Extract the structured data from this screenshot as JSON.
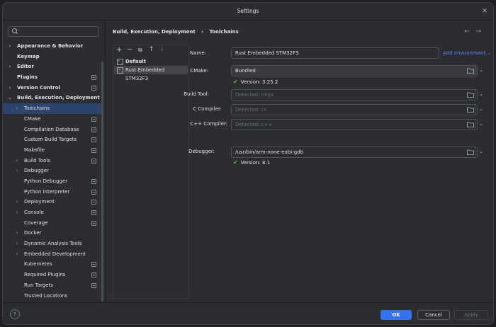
{
  "window": {
    "title": "Settings"
  },
  "search": {
    "placeholder": "",
    "value": ""
  },
  "sidebar": {
    "items": [
      {
        "label": "Appearance & Behavior",
        "level": 0,
        "arrow": "›",
        "bold": true,
        "settings_icon": false
      },
      {
        "label": "Keymap",
        "level": 0,
        "arrow": "",
        "bold": true,
        "settings_icon": false
      },
      {
        "label": "Editor",
        "level": 0,
        "arrow": "›",
        "bold": true,
        "settings_icon": false
      },
      {
        "label": "Plugins",
        "level": 0,
        "arrow": "",
        "bold": true,
        "settings_icon": true
      },
      {
        "label": "Version Control",
        "level": 0,
        "arrow": "›",
        "bold": true,
        "settings_icon": true
      },
      {
        "label": "Build, Execution, Deployment",
        "level": 0,
        "arrow": "⌄",
        "bold": true,
        "settings_icon": false
      },
      {
        "label": "Toolchains",
        "level": 1,
        "arrow": "›",
        "bold": false,
        "settings_icon": false,
        "selected": true
      },
      {
        "label": "CMake",
        "level": 1,
        "arrow": "",
        "bold": false,
        "settings_icon": true
      },
      {
        "label": "Compilation Database",
        "level": 1,
        "arrow": "",
        "bold": false,
        "settings_icon": true
      },
      {
        "label": "Custom Build Targets",
        "level": 1,
        "arrow": "",
        "bold": false,
        "settings_icon": true
      },
      {
        "label": "Makefile",
        "level": 1,
        "arrow": "",
        "bold": false,
        "settings_icon": true
      },
      {
        "label": "Build Tools",
        "level": 1,
        "arrow": "›",
        "bold": false,
        "settings_icon": true
      },
      {
        "label": "Debugger",
        "level": 1,
        "arrow": "›",
        "bold": false,
        "settings_icon": false
      },
      {
        "label": "Python Debugger",
        "level": 1,
        "arrow": "",
        "bold": false,
        "settings_icon": true
      },
      {
        "label": "Python Interpreter",
        "level": 1,
        "arrow": "",
        "bold": false,
        "settings_icon": true
      },
      {
        "label": "Deployment",
        "level": 1,
        "arrow": "›",
        "bold": false,
        "settings_icon": true
      },
      {
        "label": "Console",
        "level": 1,
        "arrow": "›",
        "bold": false,
        "settings_icon": true
      },
      {
        "label": "Coverage",
        "level": 1,
        "arrow": "",
        "bold": false,
        "settings_icon": true
      },
      {
        "label": "Docker",
        "level": 1,
        "arrow": "›",
        "bold": false,
        "settings_icon": false
      },
      {
        "label": "Dynamic Analysis Tools",
        "level": 1,
        "arrow": "›",
        "bold": false,
        "settings_icon": false
      },
      {
        "label": "Embedded Development",
        "level": 1,
        "arrow": "›",
        "bold": false,
        "settings_icon": false
      },
      {
        "label": "Kubernetes",
        "level": 1,
        "arrow": "",
        "bold": false,
        "settings_icon": true
      },
      {
        "label": "Required Plugins",
        "level": 1,
        "arrow": "",
        "bold": false,
        "settings_icon": true
      },
      {
        "label": "Run Targets",
        "level": 1,
        "arrow": "",
        "bold": false,
        "settings_icon": true
      },
      {
        "label": "Trusted Locations",
        "level": 1,
        "arrow": "",
        "bold": false,
        "settings_icon": false
      }
    ]
  },
  "breadcrumb": {
    "parent": "Build, Execution, Deployment",
    "separator": "›",
    "current": "Toolchains"
  },
  "toolchains": {
    "toolbar": {
      "add": "+",
      "remove": "−",
      "copy": "⧉",
      "up": "↑",
      "down": "↓"
    },
    "items": [
      {
        "label": "Default",
        "bold": true,
        "selected": false
      },
      {
        "label": "Rust Embedded STM32F3",
        "bold": false,
        "selected": true
      }
    ]
  },
  "form": {
    "name": {
      "label": "Name:",
      "value": "Rust Embedded STM32F3"
    },
    "add_environment": "Add environment",
    "cmake": {
      "label": "CMake:",
      "value": "Bundled",
      "version": "Version: 3.25.2"
    },
    "build_tool": {
      "label": "Build Tool:",
      "placeholder": "Detected: ninja"
    },
    "c_compiler": {
      "label": "C Compiler:",
      "placeholder": "Detected: cc"
    },
    "cpp_compiler": {
      "label": "C++ Compiler:",
      "placeholder": "Detected: c++"
    },
    "debugger": {
      "label": "Debugger:",
      "value": "/usr/bin/arm-none-eabi-gdb",
      "version": "Version: 8.1"
    }
  },
  "buttons": {
    "help": "?",
    "ok": "OK",
    "cancel": "Cancel",
    "apply": "Apply"
  },
  "colors": {
    "accent": "#3574f0",
    "selection": "#2e436e",
    "success": "#5fb865",
    "link": "#548af7"
  }
}
